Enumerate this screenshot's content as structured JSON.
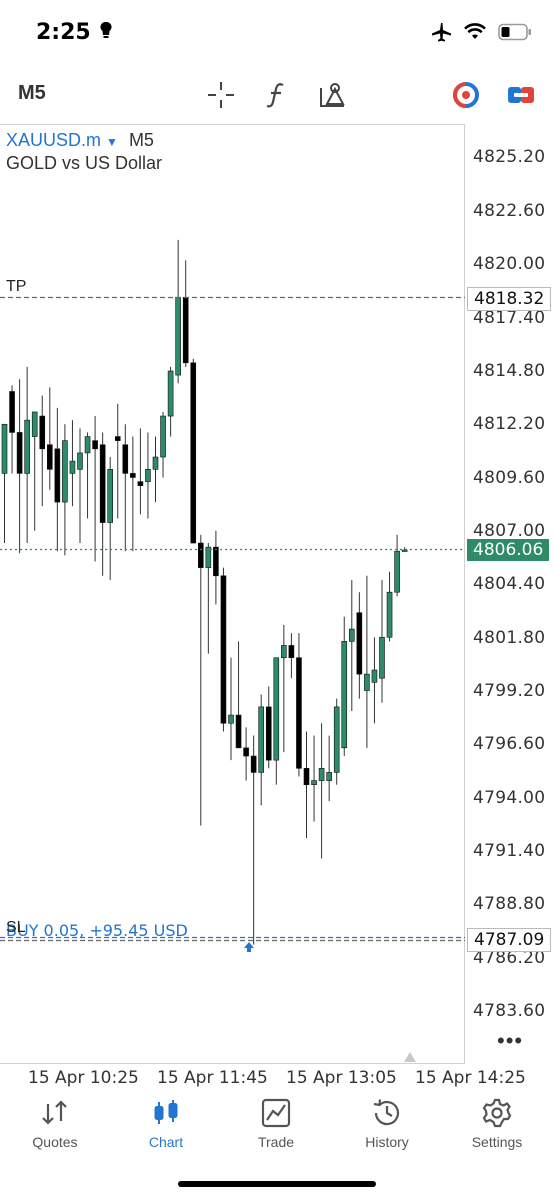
{
  "status_bar": {
    "time": "2:25"
  },
  "toolbar": {
    "timeframe": "M5",
    "icons": [
      "crosshair-icon",
      "function-icon",
      "objects-icon",
      "one-click-trading-icon",
      "trade-panel-icon"
    ]
  },
  "chart": {
    "symbol": "XAUUSD.m",
    "timeframe": "M5",
    "description": "GOLD vs US Dollar",
    "price_axis": [
      "4825.20",
      "4822.60",
      "4820.00",
      "4817.40",
      "4814.80",
      "4812.20",
      "4809.60",
      "4807.00",
      "4804.40",
      "4801.80",
      "4799.20",
      "4796.60",
      "4794.00",
      "4791.40",
      "4788.80",
      "4786.20",
      "4783.60"
    ],
    "tp_label": "TP",
    "tp_price": "4818.32",
    "current_price": "4806.06",
    "sl_label": "SL",
    "position_text": "BUY 0.05, +95.45 USD",
    "entry_price": "4787.09",
    "time_axis": [
      "15 Apr 10:25",
      "15 Apr 11:45",
      "15 Apr 13:05",
      "15 Apr 14:25"
    ],
    "colors": {
      "bull": "#2e8b68",
      "bear": "#000000",
      "tp_line": "#666666",
      "current_line": "#2e8b68",
      "position_line": "#2276d2"
    }
  },
  "chart_data": {
    "type": "candlestick",
    "symbol": "XAUUSD.m",
    "ylim": [
      4782.3,
      4827.6
    ],
    "candles": [
      {
        "o": 4809.8,
        "h": 4812.2,
        "l": 4806.4,
        "c": 4812.2
      },
      {
        "o": 4813.8,
        "h": 4814.1,
        "l": 4809.8,
        "c": 4811.8
      },
      {
        "o": 4811.8,
        "h": 4814.4,
        "l": 4805.9,
        "c": 4809.8
      },
      {
        "o": 4809.8,
        "h": 4815.0,
        "l": 4806.4,
        "c": 4812.4
      },
      {
        "o": 4811.6,
        "h": 4812.8,
        "l": 4807.0,
        "c": 4812.8
      },
      {
        "o": 4812.6,
        "h": 4813.6,
        "l": 4808.2,
        "c": 4811.0
      },
      {
        "o": 4811.2,
        "h": 4814.0,
        "l": 4809.0,
        "c": 4810.0
      },
      {
        "o": 4811.0,
        "h": 4813.0,
        "l": 4806.0,
        "c": 4808.4
      },
      {
        "o": 4808.4,
        "h": 4812.2,
        "l": 4805.8,
        "c": 4811.4
      },
      {
        "o": 4809.8,
        "h": 4812.4,
        "l": 4808.2,
        "c": 4810.4
      },
      {
        "o": 4810.0,
        "h": 4812.0,
        "l": 4806.4,
        "c": 4810.8
      },
      {
        "o": 4810.8,
        "h": 4811.8,
        "l": 4807.6,
        "c": 4811.6
      },
      {
        "o": 4811.4,
        "h": 4812.6,
        "l": 4805.5,
        "c": 4811.0
      },
      {
        "o": 4811.2,
        "h": 4811.8,
        "l": 4804.8,
        "c": 4807.4
      },
      {
        "o": 4807.4,
        "h": 4810.6,
        "l": 4804.6,
        "c": 4810.0
      },
      {
        "o": 4811.6,
        "h": 4813.2,
        "l": 4807.6,
        "c": 4811.4
      },
      {
        "o": 4811.2,
        "h": 4812.2,
        "l": 4806.0,
        "c": 4809.8
      },
      {
        "o": 4809.8,
        "h": 4811.6,
        "l": 4806.0,
        "c": 4809.6
      },
      {
        "o": 4809.4,
        "h": 4812.0,
        "l": 4807.8,
        "c": 4809.2
      },
      {
        "o": 4809.4,
        "h": 4811.8,
        "l": 4807.6,
        "c": 4810.0
      },
      {
        "o": 4810.0,
        "h": 4811.6,
        "l": 4808.4,
        "c": 4810.6
      },
      {
        "o": 4810.6,
        "h": 4812.8,
        "l": 4809.6,
        "c": 4812.6
      },
      {
        "o": 4812.6,
        "h": 4815.0,
        "l": 4811.6,
        "c": 4814.8
      },
      {
        "o": 4814.6,
        "h": 4821.2,
        "l": 4814.2,
        "c": 4818.4
      },
      {
        "o": 4818.4,
        "h": 4820.2,
        "l": 4815.0,
        "c": 4815.2
      },
      {
        "o": 4815.2,
        "h": 4815.4,
        "l": 4806.4,
        "c": 4806.4
      },
      {
        "o": 4806.4,
        "h": 4806.8,
        "l": 4792.6,
        "c": 4805.2
      },
      {
        "o": 4805.2,
        "h": 4806.4,
        "l": 4801.0,
        "c": 4806.2
      },
      {
        "o": 4806.2,
        "h": 4807.0,
        "l": 4803.4,
        "c": 4804.8
      },
      {
        "o": 4804.8,
        "h": 4805.2,
        "l": 4797.2,
        "c": 4797.6
      },
      {
        "o": 4797.6,
        "h": 4800.8,
        "l": 4795.8,
        "c": 4798.0
      },
      {
        "o": 4798.0,
        "h": 4801.6,
        "l": 4796.4,
        "c": 4796.4
      },
      {
        "o": 4796.4,
        "h": 4797.4,
        "l": 4794.8,
        "c": 4796.0
      },
      {
        "o": 4796.0,
        "h": 4797.0,
        "l": 4786.8,
        "c": 4795.2
      },
      {
        "o": 4795.2,
        "h": 4799.0,
        "l": 4793.6,
        "c": 4798.4
      },
      {
        "o": 4798.4,
        "h": 4799.4,
        "l": 4795.4,
        "c": 4795.8
      },
      {
        "o": 4795.8,
        "h": 4800.0,
        "l": 4794.6,
        "c": 4800.8
      },
      {
        "o": 4800.8,
        "h": 4802.4,
        "l": 4796.2,
        "c": 4801.4
      },
      {
        "o": 4801.4,
        "h": 4802.0,
        "l": 4799.8,
        "c": 4800.8
      },
      {
        "o": 4800.8,
        "h": 4802.0,
        "l": 4795.0,
        "c": 4795.4
      },
      {
        "o": 4795.4,
        "h": 4797.2,
        "l": 4792.0,
        "c": 4794.6
      },
      {
        "o": 4794.6,
        "h": 4797.0,
        "l": 4792.8,
        "c": 4794.8
      },
      {
        "o": 4794.8,
        "h": 4797.6,
        "l": 4791.0,
        "c": 4795.4
      },
      {
        "o": 4794.8,
        "h": 4797.0,
        "l": 4793.8,
        "c": 4795.2
      },
      {
        "o": 4795.2,
        "h": 4798.8,
        "l": 4794.6,
        "c": 4798.4
      },
      {
        "o": 4796.4,
        "h": 4802.8,
        "l": 4796.0,
        "c": 4801.6
      },
      {
        "o": 4801.6,
        "h": 4804.6,
        "l": 4798.2,
        "c": 4802.2
      },
      {
        "o": 4803.0,
        "h": 4804.0,
        "l": 4798.8,
        "c": 4800.0
      },
      {
        "o": 4799.2,
        "h": 4804.8,
        "l": 4796.4,
        "c": 4800.0
      },
      {
        "o": 4799.6,
        "h": 4801.8,
        "l": 4797.6,
        "c": 4800.2
      },
      {
        "o": 4799.8,
        "h": 4804.6,
        "l": 4798.6,
        "c": 4801.8
      },
      {
        "o": 4801.8,
        "h": 4805.0,
        "l": 4801.6,
        "c": 4804.0
      },
      {
        "o": 4804.0,
        "h": 4806.8,
        "l": 4803.8,
        "c": 4806.0
      },
      {
        "o": 4806.0,
        "h": 4806.2,
        "l": 4806.0,
        "c": 4806.06
      }
    ]
  },
  "tabs": [
    {
      "label": "Quotes",
      "icon": "quotes-icon"
    },
    {
      "label": "Chart",
      "icon": "chart-icon"
    },
    {
      "label": "Trade",
      "icon": "trade-icon"
    },
    {
      "label": "History",
      "icon": "history-icon"
    },
    {
      "label": "Settings",
      "icon": "settings-icon"
    }
  ]
}
